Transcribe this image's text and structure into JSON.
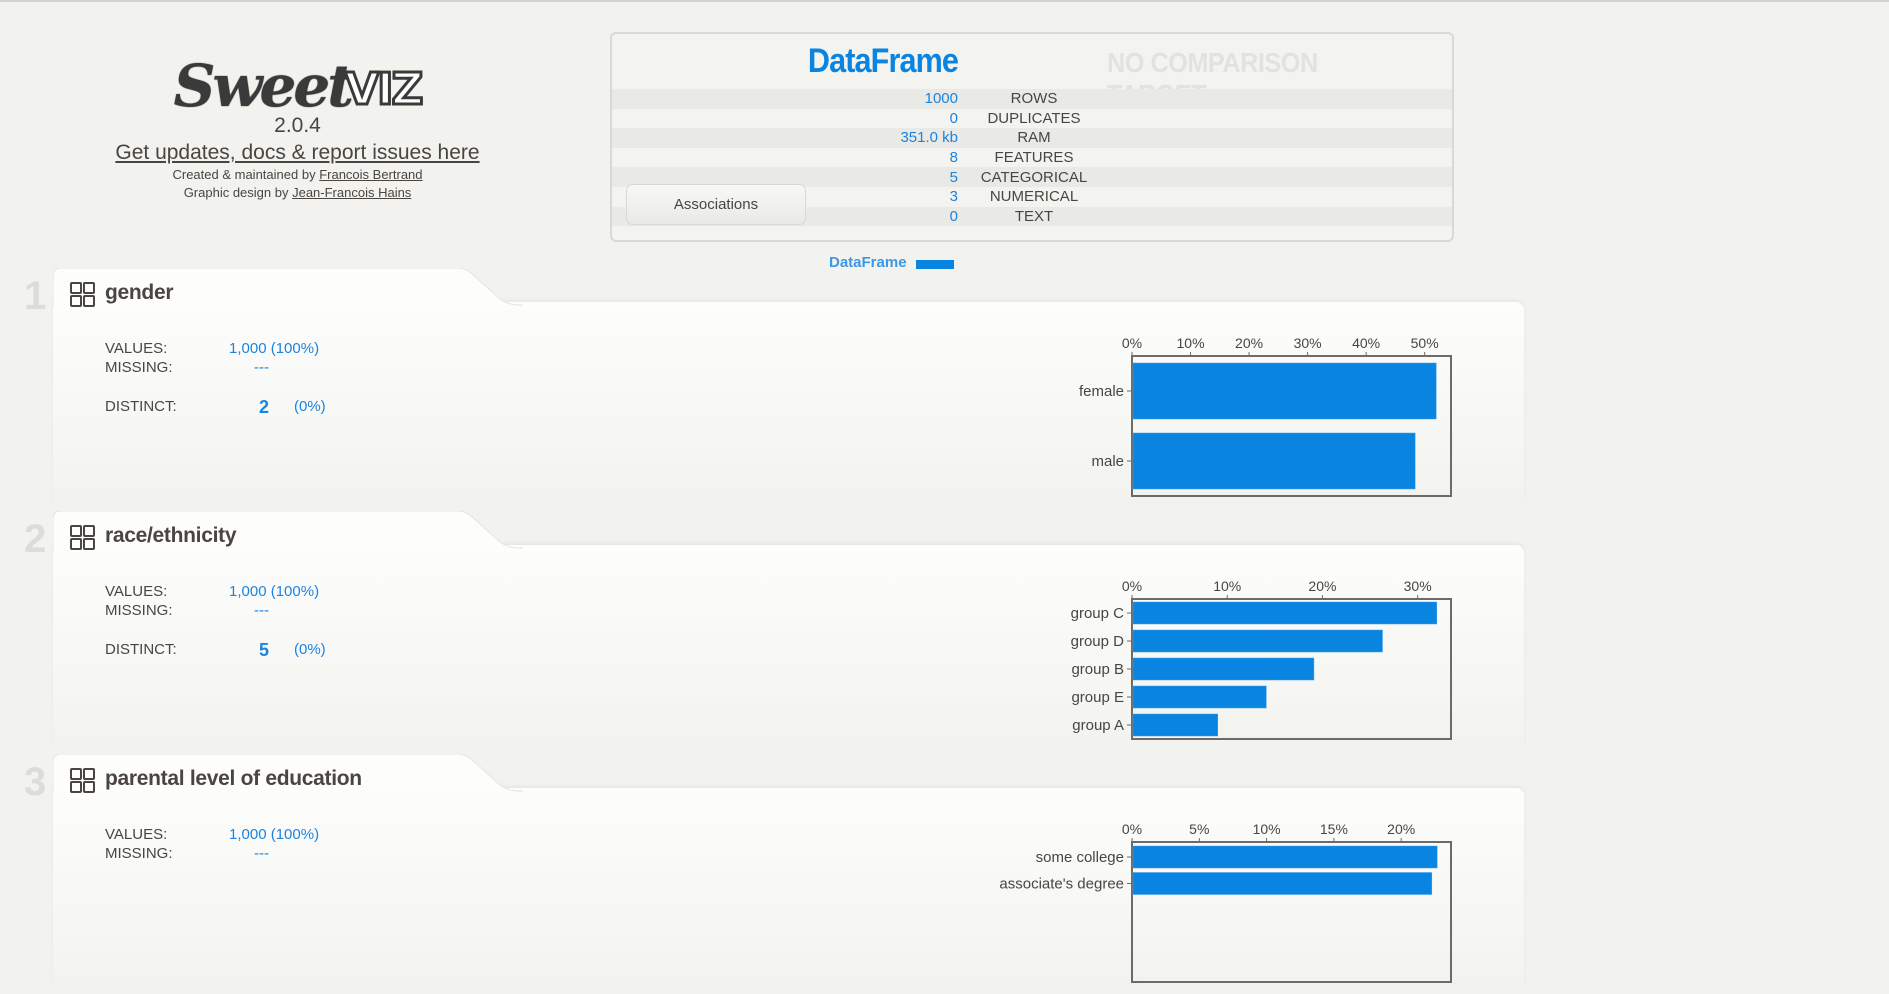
{
  "logo": {
    "brand_part1": "Sweet",
    "brand_part2": "VIZ",
    "version": "2.0.4",
    "updates_link": "Get updates, docs & report issues here",
    "created_prefix": "Created & maintained by ",
    "created_author": "Francois Bertrand",
    "design_prefix": "Graphic design by ",
    "design_author": "Jean-Francois Hains"
  },
  "summary": {
    "source_title": "DataFrame",
    "compare_title": "NO COMPARISON TARGET",
    "rows": [
      {
        "value": "1000",
        "label": "ROWS"
      },
      {
        "value": "0",
        "label": "DUPLICATES"
      },
      {
        "value": "351.0 kb",
        "label": "RAM"
      },
      {
        "value": "8",
        "label": "FEATURES"
      },
      {
        "value": "5",
        "label": "CATEGORICAL"
      },
      {
        "value": "3",
        "label": "NUMERICAL"
      },
      {
        "value": "0",
        "label": "TEXT"
      }
    ],
    "associations_button": "Associations"
  },
  "legend": {
    "label": "DataFrame",
    "color": "#0a84e1"
  },
  "labels": {
    "values": "VALUES:",
    "missing": "MISSING:",
    "distinct": "DISTINCT:"
  },
  "features": [
    {
      "index": "1",
      "name": "gender",
      "icon": "categorical-grid-icon",
      "values": "1,000 (100%)",
      "missing": "---",
      "distinct_count": "2",
      "distinct_pct": "(0%)"
    },
    {
      "index": "2",
      "name": "race/ethnicity",
      "icon": "categorical-grid-icon",
      "values": "1,000 (100%)",
      "missing": "---",
      "distinct_count": "5",
      "distinct_pct": "(0%)"
    },
    {
      "index": "3",
      "name": "parental level of education",
      "icon": "categorical-grid-icon",
      "values": "1,000 (100%)",
      "missing": "---"
    }
  ],
  "chart_data": [
    {
      "type": "bar",
      "orientation": "horizontal",
      "title": "gender",
      "categories": [
        "female",
        "male"
      ],
      "values": [
        51.8,
        48.2
      ],
      "xlabel": "",
      "ylabel": "",
      "xlim": [
        0,
        54.5
      ],
      "xticks": [
        0,
        10,
        20,
        30,
        40,
        50
      ],
      "tick_format": "percent",
      "tick_position": "top",
      "color": "#0a84e1"
    },
    {
      "type": "bar",
      "orientation": "horizontal",
      "title": "race/ethnicity",
      "categories": [
        "group C",
        "group D",
        "group B",
        "group E",
        "group A"
      ],
      "values": [
        31.9,
        26.2,
        19.0,
        14.0,
        8.9
      ],
      "xlabel": "",
      "ylabel": "",
      "xlim": [
        0,
        33.5
      ],
      "xticks": [
        0,
        10,
        20,
        30
      ],
      "tick_format": "percent",
      "tick_position": "top",
      "color": "#0a84e1"
    },
    {
      "type": "bar",
      "orientation": "horizontal",
      "title": "parental level of education",
      "categories": [
        "some college",
        "associate's degree"
      ],
      "values": [
        22.6,
        22.2
      ],
      "xlabel": "",
      "ylabel": "",
      "xlim": [
        0,
        23.7
      ],
      "xticks": [
        0,
        5,
        10,
        15,
        20
      ],
      "tick_format": "percent",
      "tick_position": "top",
      "color": "#0a84e1"
    }
  ]
}
